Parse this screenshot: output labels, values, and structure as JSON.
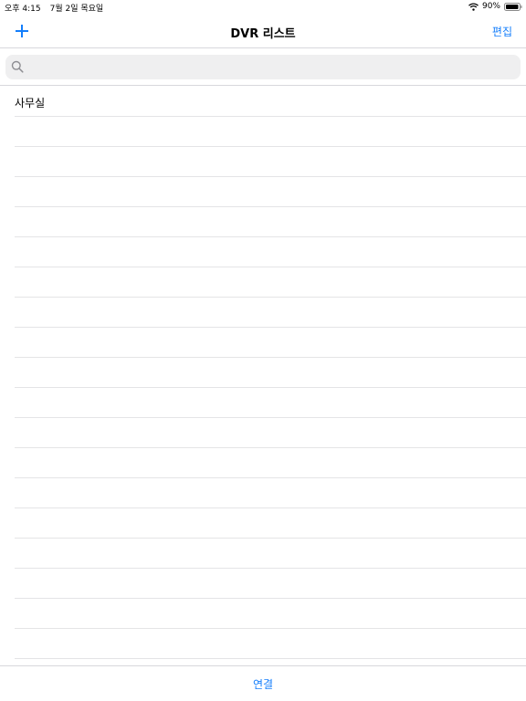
{
  "status_bar": {
    "time": "오후 4:15",
    "date": "7월 2일 목요일",
    "battery": "90%",
    "icons": [
      "wifi-icon",
      "battery-icon"
    ]
  },
  "nav": {
    "title": "DVR 리스트",
    "add_icon": "plus-icon",
    "edit_label": "편집"
  },
  "search": {
    "placeholder": "",
    "value": "",
    "icon": "search-icon"
  },
  "list": {
    "items": [
      "사무실",
      "",
      "",
      "",
      "",
      "",
      "",
      "",
      "",
      "",
      "",
      "",
      "",
      "",
      "",
      "",
      "",
      "",
      "",
      ""
    ]
  },
  "toolbar": {
    "connect_label": "연결"
  },
  "colors": {
    "accent": "#147efb",
    "separator": "#d8d8dc",
    "search_bg": "#efeff0"
  }
}
